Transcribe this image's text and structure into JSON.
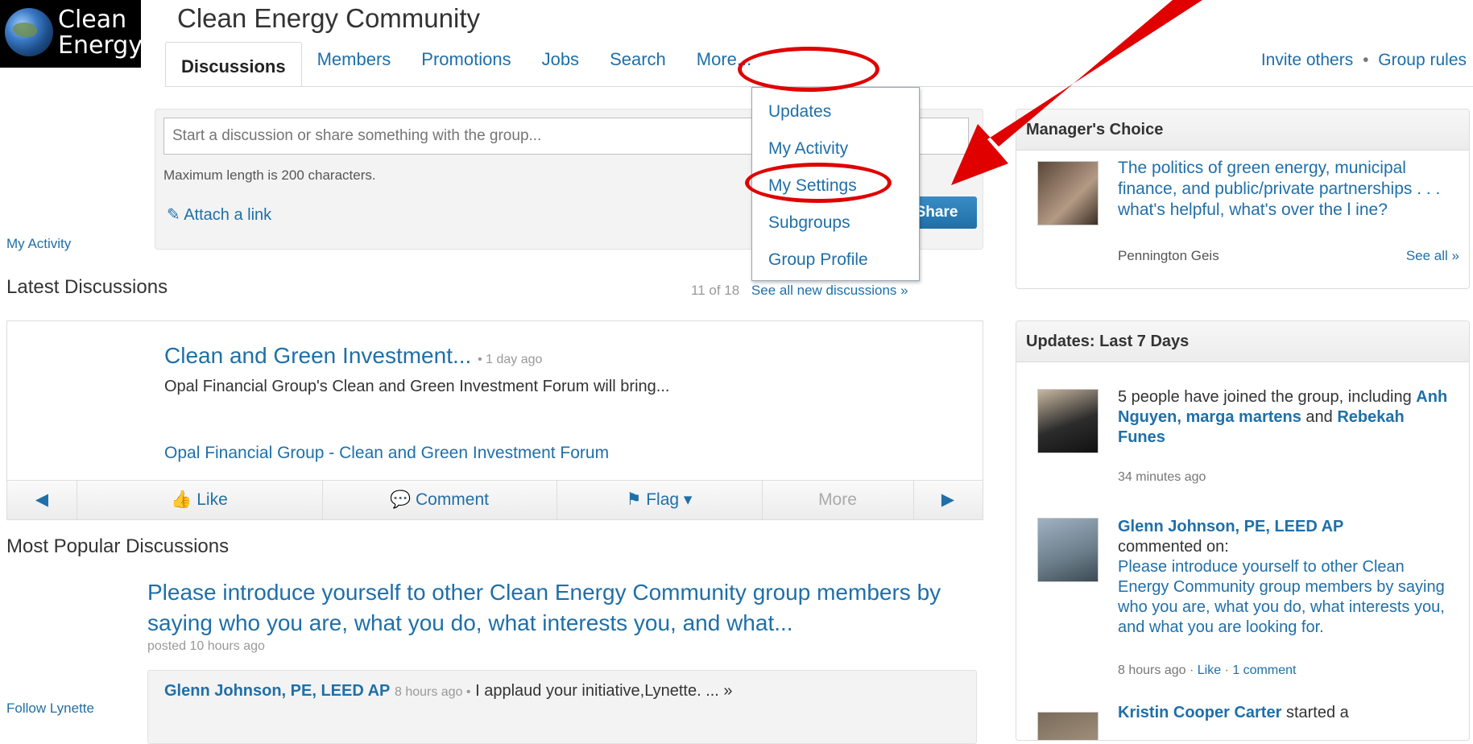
{
  "logo": {
    "line1": "Clean",
    "line2": "Energy"
  },
  "header": {
    "group_title": "Clean Energy Community",
    "tabs": [
      {
        "label": "Discussions"
      },
      {
        "label": "Members"
      },
      {
        "label": "Promotions"
      },
      {
        "label": "Jobs"
      },
      {
        "label": "Search"
      },
      {
        "label": "More..."
      }
    ],
    "invite_link": "Invite others",
    "separator": "•",
    "rules_link": "Group rules"
  },
  "dropdown": {
    "items": [
      {
        "label": "Updates"
      },
      {
        "label": "My Activity"
      },
      {
        "label": "My Settings"
      },
      {
        "label": "Subgroups"
      },
      {
        "label": "Group Profile"
      }
    ]
  },
  "share": {
    "placeholder": "Start a discussion or share something with the group...",
    "hint": "Maximum length is 200 characters.",
    "attach_label": "Attach a link",
    "share_button": "Share"
  },
  "left": {
    "my_activity": "My Activity",
    "follow": "Follow Lynette"
  },
  "latest": {
    "heading": "Latest Discussions",
    "count": "11 of 18",
    "see_all": "See all new discussions »",
    "post": {
      "title": "Clean and Green Investment...",
      "time": "• 1 day ago",
      "description": "Opal Financial Group's Clean and Green Investment Forum will bring...",
      "link": "Opal Financial Group - Clean and Green Investment Forum"
    },
    "actions": {
      "like": "Like",
      "comment": "Comment",
      "flag": "Flag ▾",
      "more": "More"
    }
  },
  "popular": {
    "heading": "Most Popular Discussions",
    "title": "Please introduce yourself to other Clean Energy Community group members by saying who you are, what you do, what interests you, and what...",
    "meta": "posted 10 hours ago",
    "reply_author": "Glenn Johnson, PE, LEED AP",
    "reply_time": "8 hours ago •",
    "reply_text": "I applaud your initiative,Lynette. ... »"
  },
  "managers_choice": {
    "heading": "Manager's Choice",
    "text": "The politics of green energy, municipal finance, and public/private partnerships . . . what's helpful, what's over the l ine?",
    "author": "Pennington Geis",
    "see_all": "See all »"
  },
  "updates": {
    "heading": "Updates: Last 7 Days",
    "item1": {
      "text_prefix": "5 people have joined the group, including",
      "names_a": "Anh Nguyen, marga martens",
      "and": "and",
      "names_b": "Rebekah Funes",
      "time": "34 minutes ago"
    },
    "item2": {
      "author": "Glenn Johnson, PE, LEED AP",
      "action": "commented on:",
      "link": "Please introduce yourself to other Clean Energy Community group members by saying who you are, what you do, what interests you, and what you are looking for.",
      "time": "8 hours ago",
      "like": "Like",
      "comments": "1 comment"
    },
    "item3": {
      "author": "Kristin Cooper Carter",
      "action": "started a"
    }
  },
  "colors": {
    "link": "#1f6fa8",
    "annotation_red": "#e00000",
    "share_button": "#1f6fa8"
  }
}
